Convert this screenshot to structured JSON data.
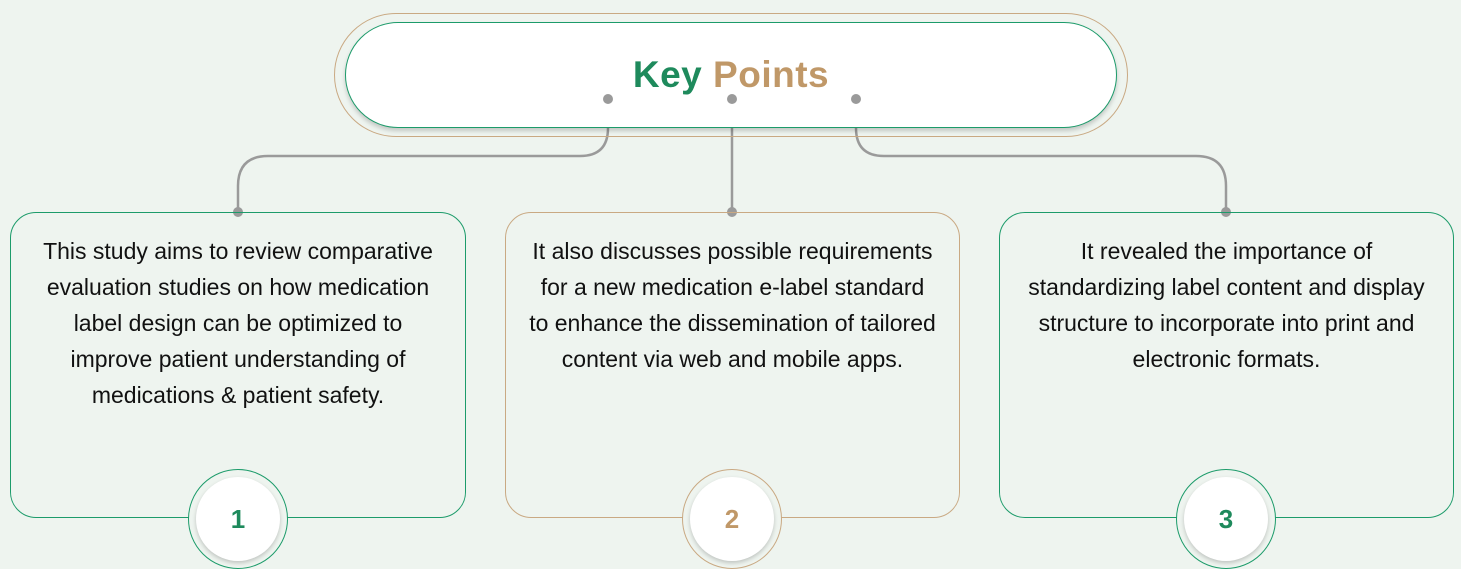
{
  "title": {
    "word1": "Key",
    "word2": "Points"
  },
  "cards": [
    {
      "number": "1",
      "text": "This study aims to review comparative evaluation studies on how medication label design can be optimized to improve patient understanding of medications & patient safety."
    },
    {
      "number": "2",
      "text": "It also discusses possible requirements for a new medication e-label standard to enhance the dissemination of tailored content via web and mobile apps."
    },
    {
      "number": "3",
      "text": "It revealed the importance of standardizing label content and display structure to incorporate into print and electronic formats."
    }
  ],
  "colors": {
    "background": "#eef4ef",
    "green": "#1e8a5c",
    "tan": "#c09868",
    "connector": "#9a9a9a"
  }
}
